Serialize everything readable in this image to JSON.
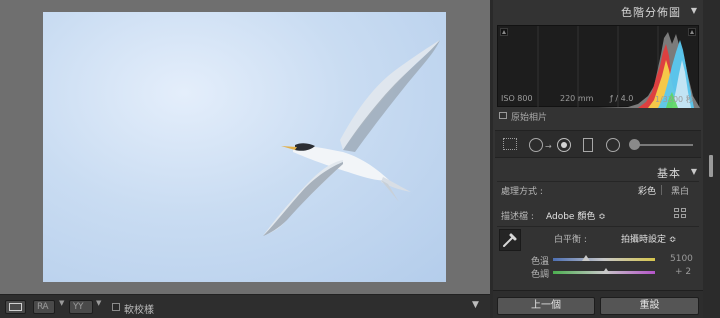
{
  "toolbar": {
    "before_after_label": "RA",
    "yy_label": "YY",
    "softproof_label": "軟校樣"
  },
  "histogram": {
    "title": "色階分佈圖",
    "iso": "ISO 800",
    "focal": "220 mm",
    "aperture": "ƒ / 4.0",
    "shutter": "1/3200 秒",
    "original_photo": "原始相片"
  },
  "basic": {
    "title": "基本",
    "treatment_label": "處理方式 :",
    "treatment_color": "彩色",
    "treatment_bw": "黑白",
    "profile_label": "描述檔 :",
    "profile_value": "Adobe 顏色 ≎",
    "wb_label": "白平衡 :",
    "wb_value": "拍攝時設定 ≎",
    "temp_label": "色溫",
    "temp_value": "5100",
    "tint_label": "色調",
    "tint_value": "+ 2"
  },
  "footer": {
    "previous_label": "上一個",
    "reset_label": "重設"
  },
  "colors": {
    "panel_bg": "#333333",
    "canvas_bg": "#6f6f6f",
    "sky": "#c9dcf2"
  },
  "icons": [
    "panel-collapse-icon",
    "clipping-indicator-icon",
    "grid-icon",
    "crop-icon",
    "spot-removal-icon",
    "redeye-icon",
    "graduated-filter-icon",
    "radial-filter-icon",
    "adjustment-brush-icon",
    "eyedropper-icon",
    "profile-browser-icon",
    "checkbox-icon",
    "dropdown-icon"
  ]
}
